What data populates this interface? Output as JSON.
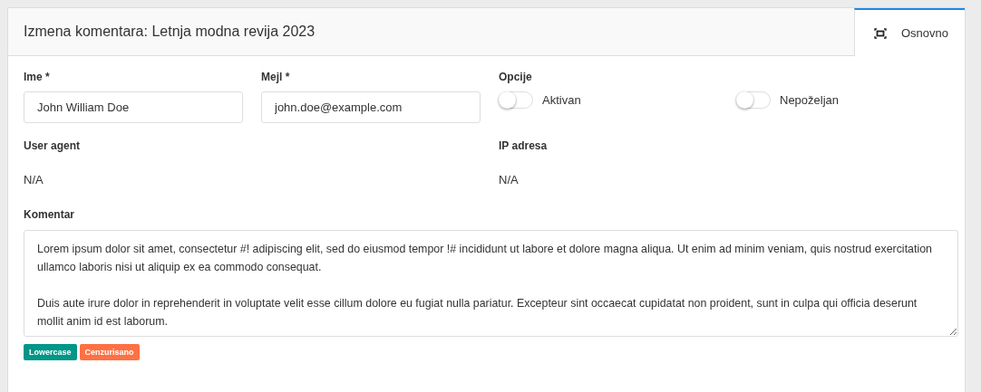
{
  "header": {
    "title": "Izmena komentara: Letnja modna revija 2023"
  },
  "tabs": [
    {
      "label": "Osnovno",
      "selected": true
    }
  ],
  "fields": [
    {
      "label": "Ime *",
      "value": "John William Doe"
    },
    {
      "label": "Mejl *",
      "value": "john.doe@example.com"
    }
  ],
  "options": {
    "label": "Opcije",
    "toggles": [
      {
        "label": "Aktivan",
        "on": false
      },
      {
        "label": "Nepoželjan",
        "on": false
      }
    ]
  },
  "info": [
    {
      "label": "User agent",
      "value": "N/A"
    },
    {
      "label": "IP adresa",
      "value": "N/A"
    }
  ],
  "comment": {
    "label": "Komentar",
    "value": "Lorem ipsum dolor sit amet, consectetur #! adipiscing elit, sed do eiusmod tempor !# incididunt ut labore et dolore magna aliqua. Ut enim ad minim veniam, quis nostrud exercitation ullamco laboris nisi ut aliquip ex ea commodo consequat.\n\nDuis aute irure dolor in reprehenderit in voluptate velit esse cillum dolore eu fugiat nulla pariatur. Excepteur sint occaecat cupidatat non proident, sunt in culpa qui officia deserunt mollit anim id est laborum."
  },
  "tags": [
    {
      "label": "Lowercase",
      "color": "#009688"
    },
    {
      "label": "Cenzurisano",
      "color": "#ff7043"
    }
  ]
}
